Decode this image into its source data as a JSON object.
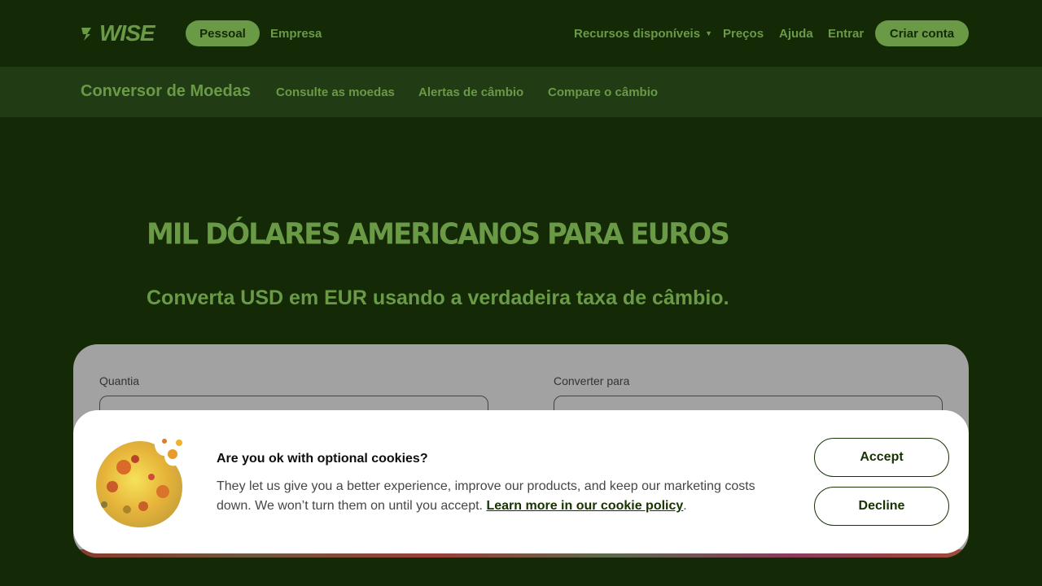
{
  "header": {
    "logo_text": "WISE",
    "tabs": [
      {
        "label": "Pessoal",
        "active": true
      },
      {
        "label": "Empresa",
        "active": false
      }
    ],
    "nav": {
      "resources": "Recursos disponíveis",
      "prices": "Preços",
      "help": "Ajuda",
      "login": "Entrar",
      "signup": "Criar conta"
    }
  },
  "subnav": {
    "title": "Conversor de Moedas",
    "links": [
      "Consulte as moedas",
      "Alertas de câmbio",
      "Compare o câmbio"
    ]
  },
  "hero": {
    "title": "MIL DÓLARES AMERICANOS PARA EUROS",
    "subtitle": "Converta USD em EUR usando a verdadeira taxa de câmbio."
  },
  "converter": {
    "amount_label": "Quantia",
    "convert_to_label": "Converter para"
  },
  "cookie_banner": {
    "title": "Are you ok with optional cookies?",
    "text": "They let us give you a better experience, improve our products, and keep our marketing costs down. We won’t turn them on until you accept.",
    "link_text": "Learn more in our cookie policy",
    "after_link": ".",
    "accept": "Accept",
    "decline": "Decline"
  },
  "colors": {
    "background": "#142a07",
    "subnav_bg": "#213b14",
    "accent_green": "#6a9a46",
    "dark_green": "#163300"
  }
}
